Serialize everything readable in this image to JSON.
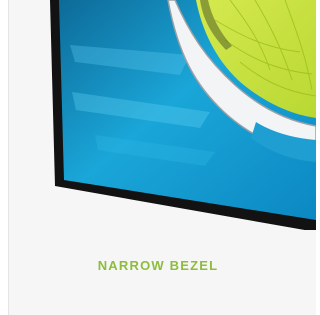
{
  "feature": {
    "label": "NARROW BEZEL"
  },
  "colors": {
    "accent": "#8dbd3a",
    "screen": "#1aa6d8",
    "bezel": "#111111",
    "shoe": "#c8e14a"
  },
  "icons": {
    "monitor": "monitor-corner-image"
  }
}
